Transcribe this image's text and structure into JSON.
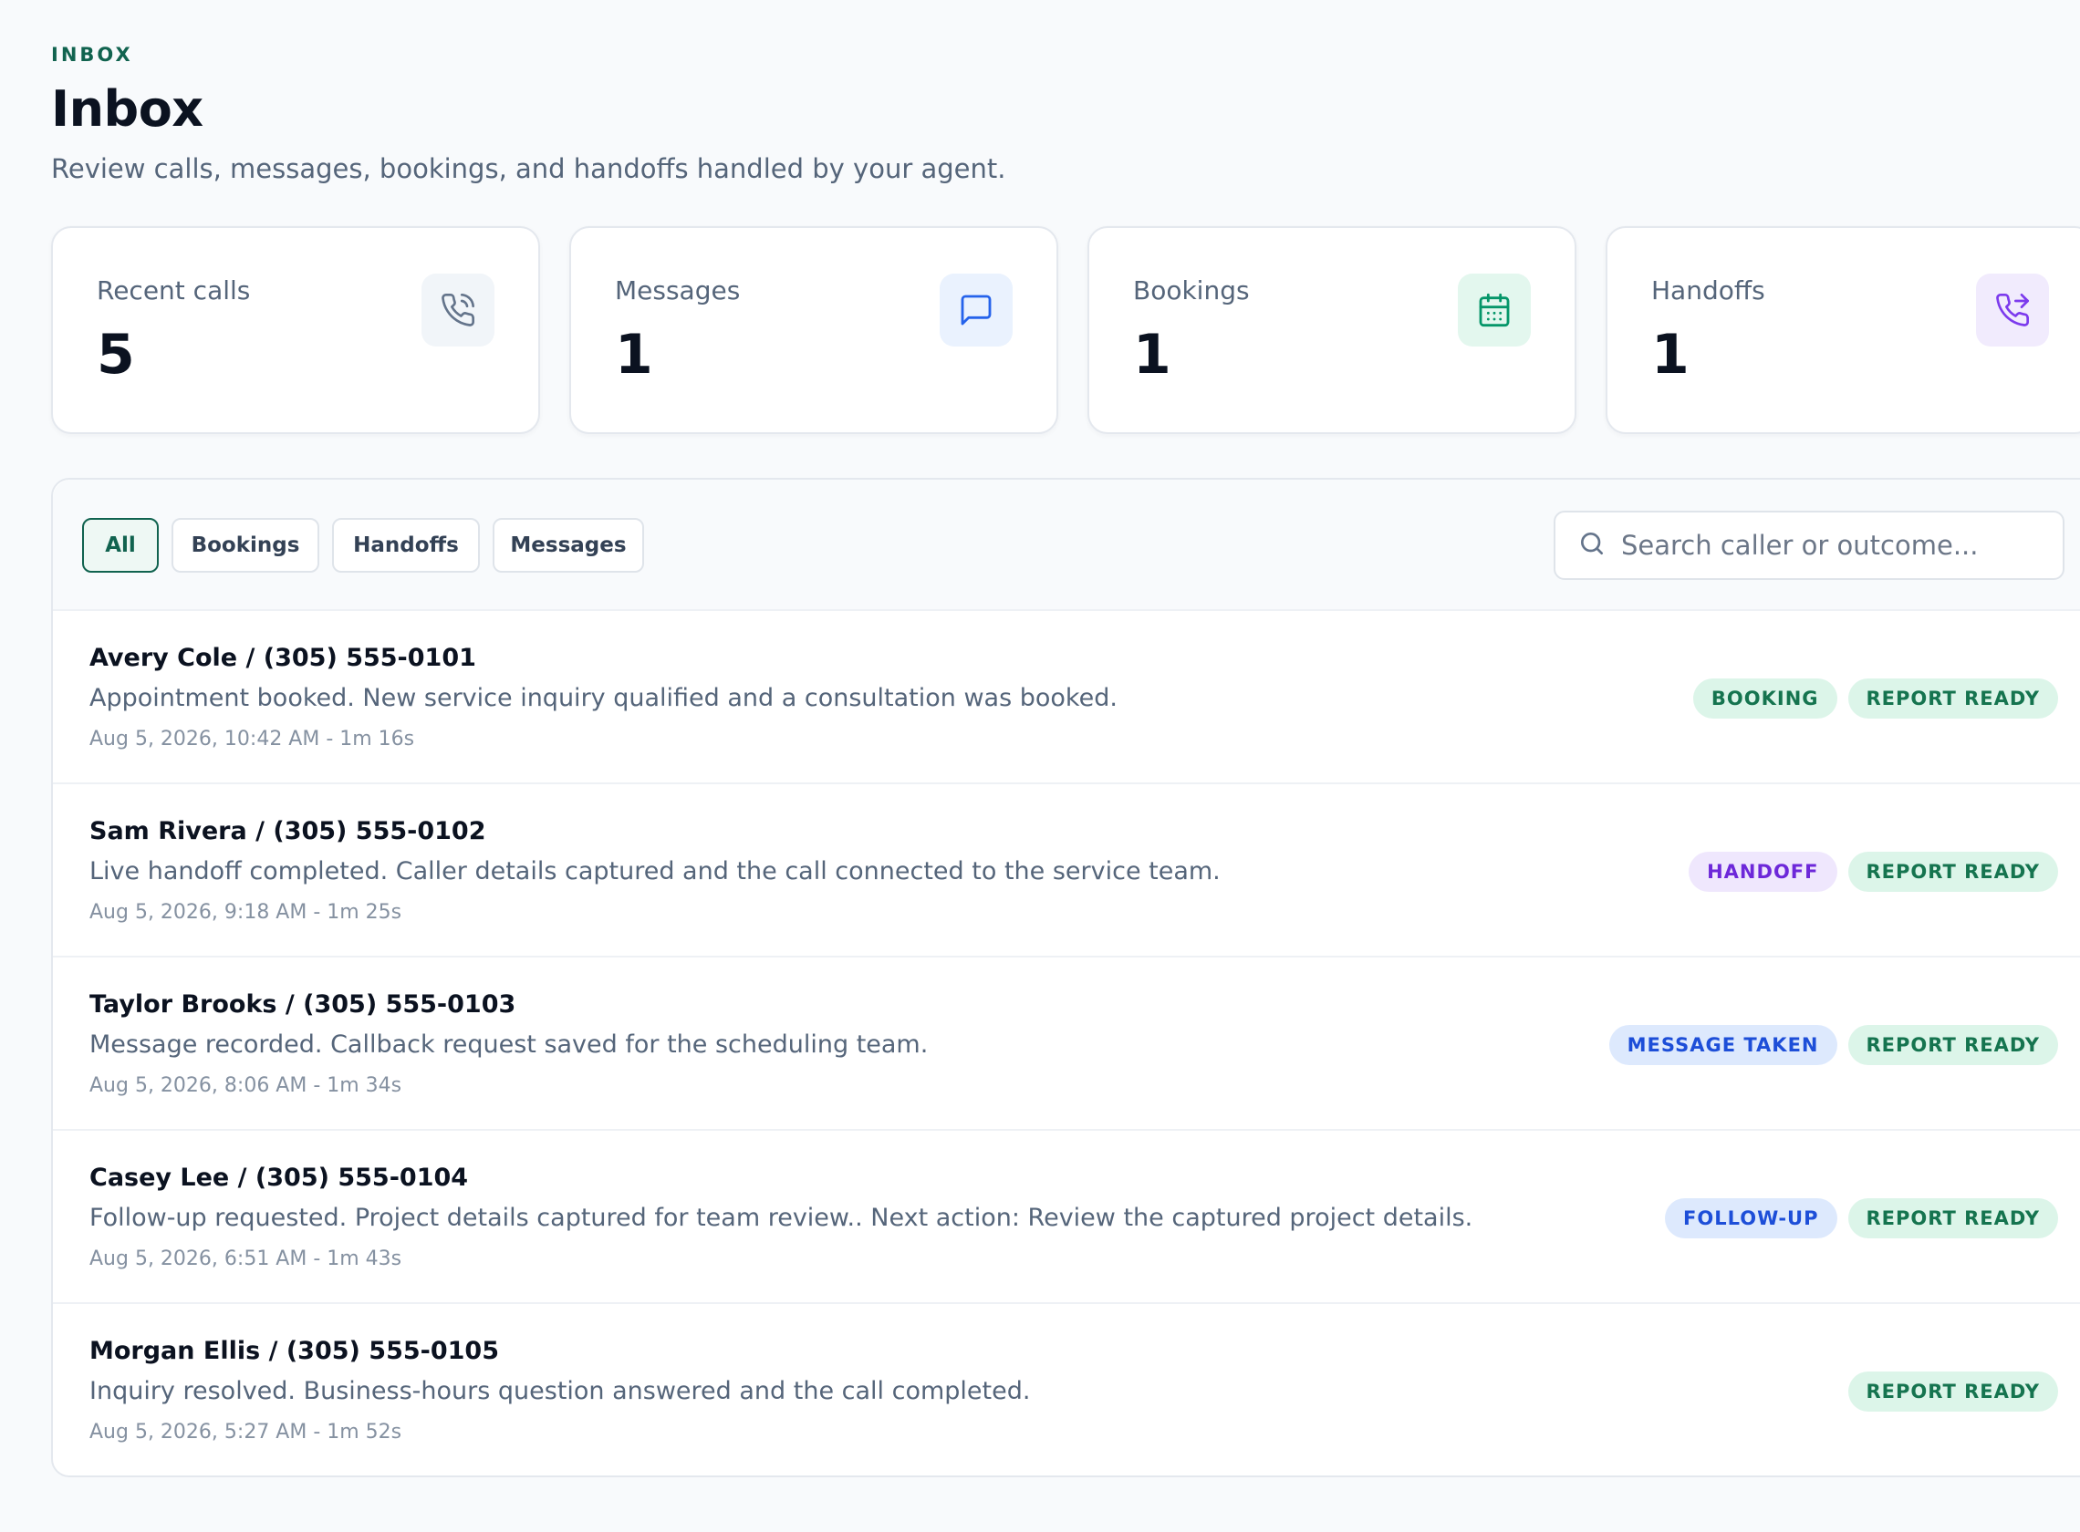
{
  "header": {
    "eyebrow": "INBOX",
    "title": "Inbox",
    "subtitle": "Review calls, messages, bookings, and handoffs handled by your agent."
  },
  "stats": [
    {
      "label": "Recent calls",
      "value": "5",
      "icon": "phone-icon",
      "color": "#64748b",
      "bg": "#f1f5f9"
    },
    {
      "label": "Messages",
      "value": "1",
      "icon": "chat-bubble-icon",
      "color": "#2563eb",
      "bg": "#eaf2fe"
    },
    {
      "label": "Bookings",
      "value": "1",
      "icon": "calendar-icon",
      "color": "#059669",
      "bg": "#e3f7ee"
    },
    {
      "label": "Handoffs",
      "value": "1",
      "icon": "phone-forward-icon",
      "color": "#7c3aed",
      "bg": "#f1ebfd"
    }
  ],
  "filters": [
    {
      "label": "All",
      "active": true
    },
    {
      "label": "Bookings",
      "active": false
    },
    {
      "label": "Handoffs",
      "active": false
    },
    {
      "label": "Messages",
      "active": false
    }
  ],
  "search": {
    "placeholder": "Search caller or outcome...",
    "value": ""
  },
  "calls": [
    {
      "title": "Avery Cole / (305) 555-0101",
      "summary": "Appointment booked. New service inquiry qualified and a consultation was booked.",
      "meta": "Aug 5, 2026, 10:42 AM - 1m 16s",
      "badges": [
        {
          "label": "BOOKING",
          "tone": "green"
        },
        {
          "label": "REPORT READY",
          "tone": "green"
        }
      ]
    },
    {
      "title": "Sam Rivera / (305) 555-0102",
      "summary": "Live handoff completed. Caller details captured and the call connected to the service team.",
      "meta": "Aug 5, 2026, 9:18 AM - 1m 25s",
      "badges": [
        {
          "label": "HANDOFF",
          "tone": "purple"
        },
        {
          "label": "REPORT READY",
          "tone": "green"
        }
      ]
    },
    {
      "title": "Taylor Brooks / (305) 555-0103",
      "summary": "Message recorded. Callback request saved for the scheduling team.",
      "meta": "Aug 5, 2026, 8:06 AM - 1m 34s",
      "badges": [
        {
          "label": "MESSAGE TAKEN",
          "tone": "blue"
        },
        {
          "label": "REPORT READY",
          "tone": "green"
        }
      ]
    },
    {
      "title": "Casey Lee / (305) 555-0104",
      "summary": "Follow-up requested. Project details captured for team review.. Next action: Review the captured project details.",
      "meta": "Aug 5, 2026, 6:51 AM - 1m 43s",
      "badges": [
        {
          "label": "FOLLOW-UP",
          "tone": "blue"
        },
        {
          "label": "REPORT READY",
          "tone": "green"
        }
      ]
    },
    {
      "title": "Morgan Ellis / (305) 555-0105",
      "summary": "Inquiry resolved. Business-hours question answered and the call completed.",
      "meta": "Aug 5, 2026, 5:27 AM - 1m 52s",
      "badges": [
        {
          "label": "REPORT READY",
          "tone": "green"
        }
      ]
    }
  ],
  "colors": {
    "accent": "#11634f",
    "background": "#f8fafc",
    "text_muted": "#55657a"
  }
}
